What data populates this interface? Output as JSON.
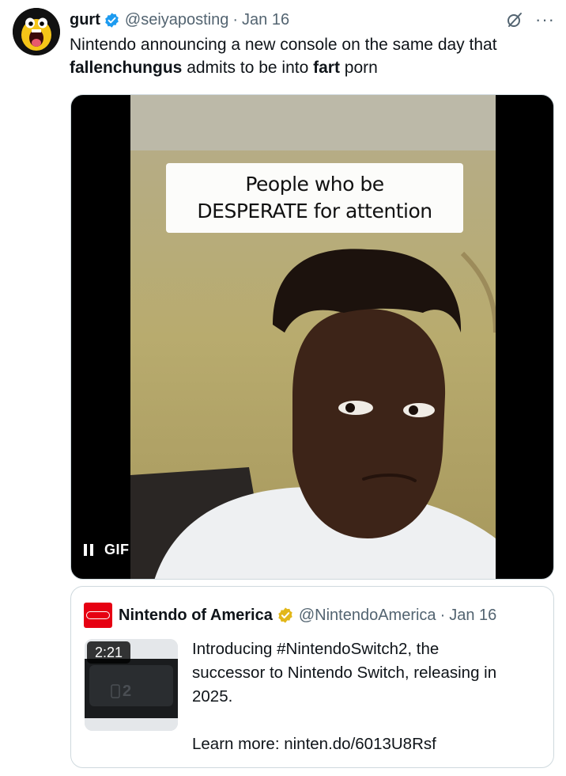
{
  "tweet": {
    "display_name": "gurt",
    "handle": "@seiyaposting",
    "separator": "·",
    "date": "Jan 16",
    "more": "···",
    "text_parts": [
      "Nintendo announcing a new console on the same day that ",
      "fallenchungus",
      " admits to be into ",
      "fart",
      " porn"
    ]
  },
  "media": {
    "caption_line1": "People who be",
    "caption_line2": "DESPERATE for attention",
    "gif_label": "GIF"
  },
  "quote": {
    "display_name": "Nintendo of America",
    "handle": "@NintendoAmerica",
    "separator": "·",
    "date": "Jan 16",
    "video_duration": "2:21",
    "text_line1": "Introducing #NintendoSwitch2, the",
    "text_line2": "successor to Nintendo Switch, releasing in",
    "text_line3": "2025.",
    "learn_more": "Learn more: ninten.do/6013U8Rsf"
  },
  "colors": {
    "verified_blue": "#1d9bf0",
    "verified_gold": "#e2b719",
    "nintendo_red": "#e60012",
    "secondary_text": "#536471",
    "border": "#cfd9de"
  },
  "icons": {
    "verified": "verified-badge-icon",
    "grok": "grok-icon",
    "more": "more-icon",
    "pause": "pause-icon",
    "gold_verified": "gold-verified-badge-icon",
    "logo": "nintendo-logo-icon"
  }
}
